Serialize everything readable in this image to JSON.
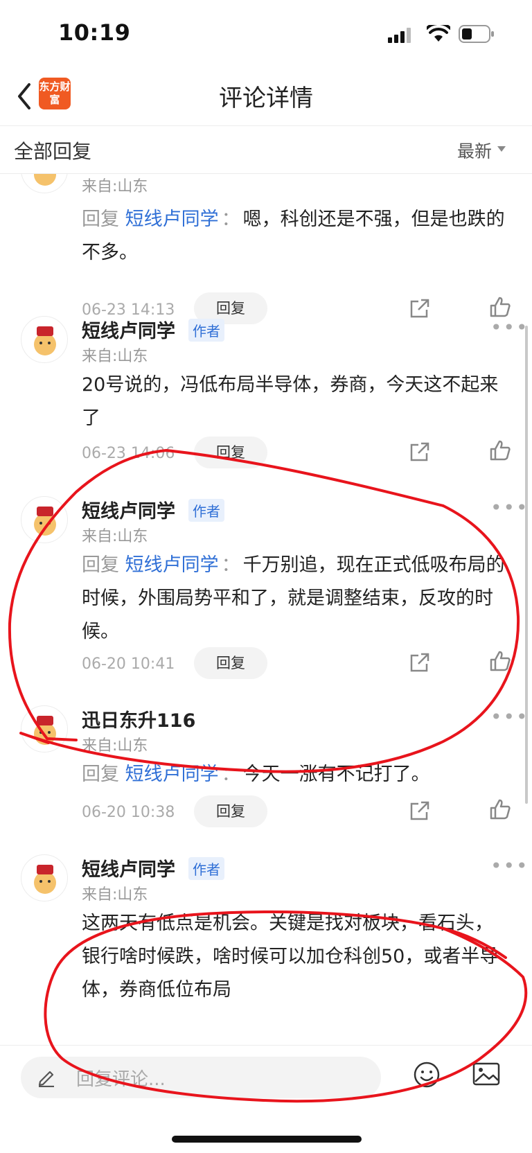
{
  "status_bar": {
    "time": "10:19"
  },
  "nav": {
    "title": "评论详情",
    "logo_text": "东方财富"
  },
  "filter": {
    "title": "全部回复",
    "sort_label": "最新"
  },
  "reply_prefix": "回复",
  "colon": "：",
  "reply_button_label": "回复",
  "comments": [
    {
      "location": "来自:山东",
      "is_reply": true,
      "mention": "短线卢同学",
      "text": "嗯，科创还是不强，但是也跌的不多。",
      "time": "06-23 14:13"
    },
    {
      "username": "短线卢同学",
      "badge": "作者",
      "location": "来自:山东",
      "text": "20号说的，冯低布局半导体，券商，今天这不起来了",
      "time": "06-23 14:06"
    },
    {
      "username": "短线卢同学",
      "badge": "作者",
      "location": "来自:山东",
      "is_reply": true,
      "mention": "短线卢同学",
      "text": "千万别追，现在正式低吸布局的时候，外围局势平和了，就是调整结束，反攻的时候。",
      "time": "06-20 10:41"
    },
    {
      "username": "迅日东升116",
      "location": "来自:山东",
      "is_reply": true,
      "mention": "短线卢同学",
      "text": "今天一涨有不记打了。",
      "time": "06-20 10:38"
    },
    {
      "username": "短线卢同学",
      "badge": "作者",
      "location": "来自:山东",
      "text": "这两天有低点是机会。关键是找对板块，看石头，银行啥时候跌，啥时候可以加仓科创50，或者半导体，券商低位布局"
    }
  ],
  "bottom": {
    "placeholder": "回复评论..."
  },
  "colors": {
    "accent": "#2f6fd6",
    "brand": "#f05a22",
    "annotation": "#e8141c"
  },
  "icons": [
    "back-icon",
    "signal-icon",
    "wifi-icon",
    "battery-icon",
    "more-icon",
    "share-icon",
    "like-icon",
    "pencil-icon",
    "emoji-icon",
    "image-icon",
    "avatar-icon"
  ]
}
